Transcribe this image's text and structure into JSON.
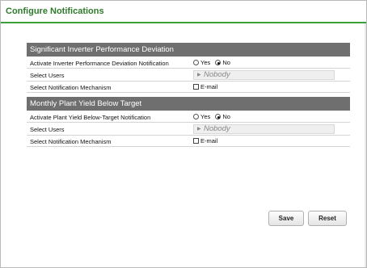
{
  "page": {
    "title": "Configure Notifications"
  },
  "sections": [
    {
      "header": "Significant Inverter Performance Deviation",
      "activate_label": "Activate Inverter Performance Deviation Notification",
      "yes_label": "Yes",
      "no_label": "No",
      "selected": "No",
      "users_label": "Select Users",
      "users_value": "Nobody",
      "mechanism_label": "Select Notification Mechanism",
      "email_label": "E-mail",
      "email_checked": false
    },
    {
      "header": "Monthly Plant Yield Below Target",
      "activate_label": "Activate Plant Yield Below-Target Notification",
      "yes_label": "Yes",
      "no_label": "No",
      "selected": "No",
      "users_label": "Select Users",
      "users_value": "Nobody",
      "mechanism_label": "Select Notification Mechanism",
      "email_label": "E-mail",
      "email_checked": false
    }
  ],
  "buttons": {
    "save_label": "Save",
    "reset_label": "Reset"
  },
  "colors": {
    "accent": "#3aa037",
    "title_text": "#2d7a2a",
    "section_header_bg": "#6f6f6f"
  }
}
